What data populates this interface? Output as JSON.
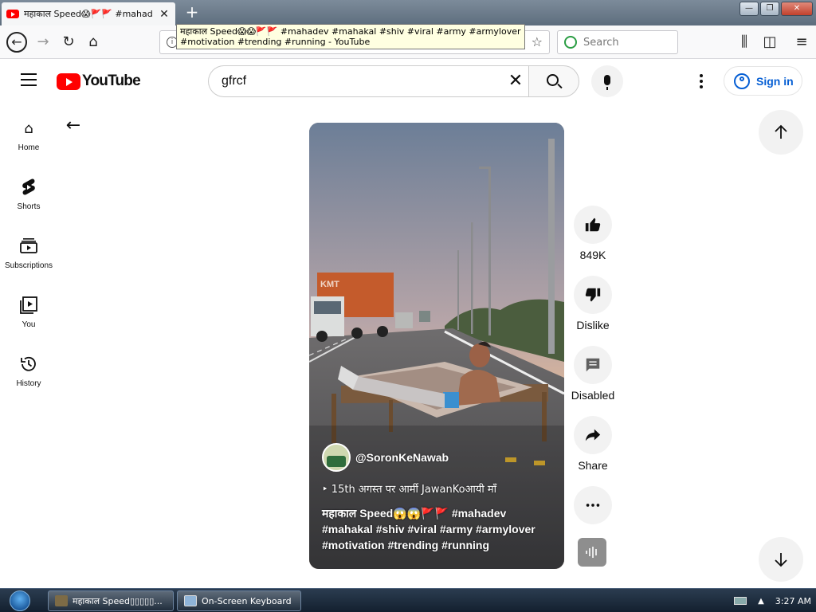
{
  "browser": {
    "tab_title": "महाकाल Speed😱🚩🚩 #mahad",
    "tab_close_glyph": "✕",
    "new_tab_glyph": "+",
    "tooltip": "महाकाल Speed😱😱🚩🚩 #mahadev #mahakal #shiv #viral #army #armylover #motivation #trending #running - YouTube",
    "search_placeholder": "Search",
    "window_buttons": [
      "—",
      "❐",
      "✕"
    ]
  },
  "header": {
    "logo_text": "YouTube",
    "search_value": "gfrcf",
    "signin_label": "Sign in"
  },
  "sidebar": {
    "items": [
      {
        "label": "Home",
        "icon": "home-icon"
      },
      {
        "label": "Shorts",
        "icon": "shorts-icon"
      },
      {
        "label": "Subscriptions",
        "icon": "subscriptions-icon"
      },
      {
        "label": "You",
        "icon": "you-icon"
      },
      {
        "label": "History",
        "icon": "history-icon"
      }
    ]
  },
  "short": {
    "channel": "@SoronKeNawab",
    "subtitle": "‣ 15th अगस्त पर आर्मी JawanKoआयी माँ",
    "caption": "महाकाल Speed😱😱🚩🚩 #mahadev #mahakal #shiv #viral #army #armylover #motivation #trending #running"
  },
  "actions": {
    "like_count": "849K",
    "dislike_label": "Dislike",
    "comments_label": "Disabled",
    "share_label": "Share"
  },
  "taskbar": {
    "items": [
      {
        "label": "महाकाल Speed▯▯▯▯▯..."
      },
      {
        "label": "On-Screen Keyboard"
      }
    ],
    "clock": "3:27 AM"
  },
  "colors": {
    "brand_red": "#ff0000",
    "link_blue": "#065fd4",
    "chip_bg": "#f2f2f2"
  }
}
